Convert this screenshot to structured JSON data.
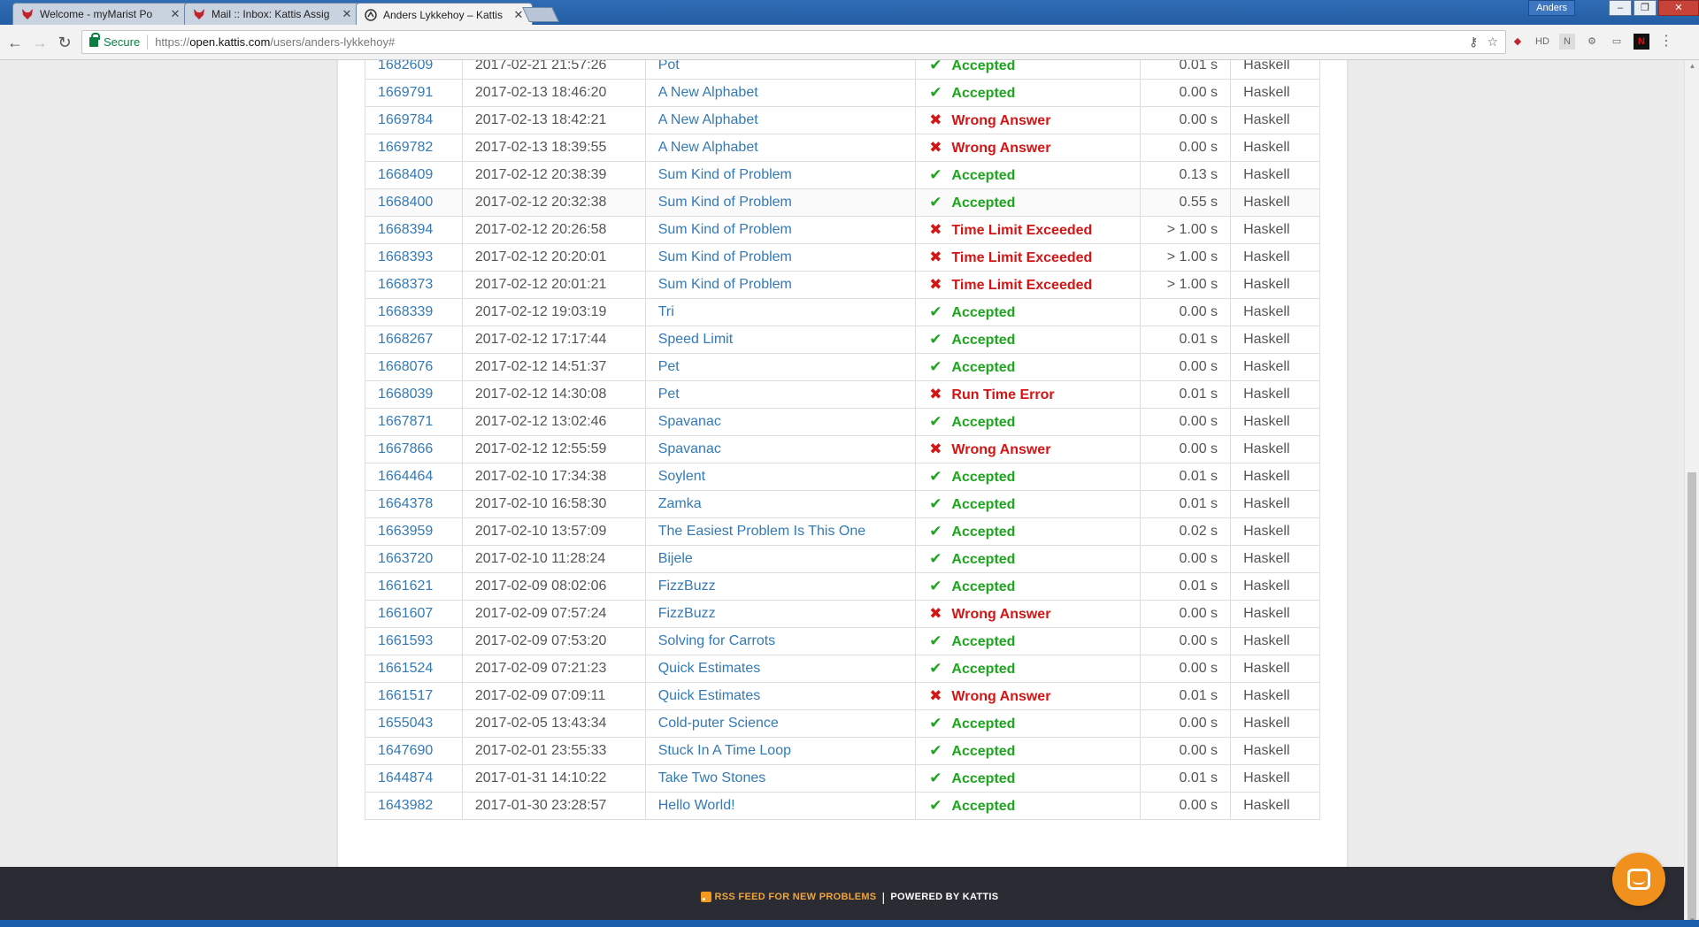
{
  "browser": {
    "tabs": [
      {
        "title": "Welcome - myMarist Po",
        "icon": "marist-fox-icon",
        "active": false
      },
      {
        "title": "Mail :: Inbox: Kattis Assig",
        "icon": "marist-fox-icon",
        "active": false
      },
      {
        "title": "Anders Lykkehoy – Kattis",
        "icon": "kattis-icon",
        "active": true
      }
    ],
    "user_chip": "Anders",
    "secure_label": "Secure",
    "url_scheme": "https://",
    "url_domain": "open.kattis.com",
    "url_path": "/users/anders-lykkehoy#",
    "ext_labels": [
      "HD",
      "N"
    ]
  },
  "submissions": {
    "rows": [
      {
        "id": "1682609",
        "time": "2017-02-21 21:57:26",
        "problem": "Pot",
        "status": "Accepted",
        "ok": true,
        "cpu": "0.01 s",
        "lang": "Haskell"
      },
      {
        "id": "1669791",
        "time": "2017-02-13 18:46:20",
        "problem": "A New Alphabet",
        "status": "Accepted",
        "ok": true,
        "cpu": "0.00 s",
        "lang": "Haskell"
      },
      {
        "id": "1669784",
        "time": "2017-02-13 18:42:21",
        "problem": "A New Alphabet",
        "status": "Wrong Answer",
        "ok": false,
        "cpu": "0.00 s",
        "lang": "Haskell"
      },
      {
        "id": "1669782",
        "time": "2017-02-13 18:39:55",
        "problem": "A New Alphabet",
        "status": "Wrong Answer",
        "ok": false,
        "cpu": "0.00 s",
        "lang": "Haskell"
      },
      {
        "id": "1668409",
        "time": "2017-02-12 20:38:39",
        "problem": "Sum Kind of Problem",
        "status": "Accepted",
        "ok": true,
        "cpu": "0.13 s",
        "lang": "Haskell"
      },
      {
        "id": "1668400",
        "time": "2017-02-12 20:32:38",
        "problem": "Sum Kind of Problem",
        "status": "Accepted",
        "ok": true,
        "cpu": "0.55 s",
        "lang": "Haskell"
      },
      {
        "id": "1668394",
        "time": "2017-02-12 20:26:58",
        "problem": "Sum Kind of Problem",
        "status": "Time Limit Exceeded",
        "ok": false,
        "cpu": "> 1.00 s",
        "lang": "Haskell"
      },
      {
        "id": "1668393",
        "time": "2017-02-12 20:20:01",
        "problem": "Sum Kind of Problem",
        "status": "Time Limit Exceeded",
        "ok": false,
        "cpu": "> 1.00 s",
        "lang": "Haskell"
      },
      {
        "id": "1668373",
        "time": "2017-02-12 20:01:21",
        "problem": "Sum Kind of Problem",
        "status": "Time Limit Exceeded",
        "ok": false,
        "cpu": "> 1.00 s",
        "lang": "Haskell"
      },
      {
        "id": "1668339",
        "time": "2017-02-12 19:03:19",
        "problem": "Tri",
        "status": "Accepted",
        "ok": true,
        "cpu": "0.00 s",
        "lang": "Haskell"
      },
      {
        "id": "1668267",
        "time": "2017-02-12 17:17:44",
        "problem": "Speed Limit",
        "status": "Accepted",
        "ok": true,
        "cpu": "0.01 s",
        "lang": "Haskell"
      },
      {
        "id": "1668076",
        "time": "2017-02-12 14:51:37",
        "problem": "Pet",
        "status": "Accepted",
        "ok": true,
        "cpu": "0.00 s",
        "lang": "Haskell"
      },
      {
        "id": "1668039",
        "time": "2017-02-12 14:30:08",
        "problem": "Pet",
        "status": "Run Time Error",
        "ok": false,
        "cpu": "0.01 s",
        "lang": "Haskell"
      },
      {
        "id": "1667871",
        "time": "2017-02-12 13:02:46",
        "problem": "Spavanac",
        "status": "Accepted",
        "ok": true,
        "cpu": "0.00 s",
        "lang": "Haskell"
      },
      {
        "id": "1667866",
        "time": "2017-02-12 12:55:59",
        "problem": "Spavanac",
        "status": "Wrong Answer",
        "ok": false,
        "cpu": "0.00 s",
        "lang": "Haskell"
      },
      {
        "id": "1664464",
        "time": "2017-02-10 17:34:38",
        "problem": "Soylent",
        "status": "Accepted",
        "ok": true,
        "cpu": "0.01 s",
        "lang": "Haskell"
      },
      {
        "id": "1664378",
        "time": "2017-02-10 16:58:30",
        "problem": "Zamka",
        "status": "Accepted",
        "ok": true,
        "cpu": "0.01 s",
        "lang": "Haskell"
      },
      {
        "id": "1663959",
        "time": "2017-02-10 13:57:09",
        "problem": "The Easiest Problem Is This One",
        "status": "Accepted",
        "ok": true,
        "cpu": "0.02 s",
        "lang": "Haskell"
      },
      {
        "id": "1663720",
        "time": "2017-02-10 11:28:24",
        "problem": "Bijele",
        "status": "Accepted",
        "ok": true,
        "cpu": "0.00 s",
        "lang": "Haskell"
      },
      {
        "id": "1661621",
        "time": "2017-02-09 08:02:06",
        "problem": "FizzBuzz",
        "status": "Accepted",
        "ok": true,
        "cpu": "0.01 s",
        "lang": "Haskell"
      },
      {
        "id": "1661607",
        "time": "2017-02-09 07:57:24",
        "problem": "FizzBuzz",
        "status": "Wrong Answer",
        "ok": false,
        "cpu": "0.00 s",
        "lang": "Haskell"
      },
      {
        "id": "1661593",
        "time": "2017-02-09 07:53:20",
        "problem": "Solving for Carrots",
        "status": "Accepted",
        "ok": true,
        "cpu": "0.00 s",
        "lang": "Haskell"
      },
      {
        "id": "1661524",
        "time": "2017-02-09 07:21:23",
        "problem": "Quick Estimates",
        "status": "Accepted",
        "ok": true,
        "cpu": "0.00 s",
        "lang": "Haskell"
      },
      {
        "id": "1661517",
        "time": "2017-02-09 07:09:11",
        "problem": "Quick Estimates",
        "status": "Wrong Answer",
        "ok": false,
        "cpu": "0.01 s",
        "lang": "Haskell"
      },
      {
        "id": "1655043",
        "time": "2017-02-05 13:43:34",
        "problem": "Cold-puter Science",
        "status": "Accepted",
        "ok": true,
        "cpu": "0.00 s",
        "lang": "Haskell"
      },
      {
        "id": "1647690",
        "time": "2017-02-01 23:55:33",
        "problem": "Stuck In A Time Loop",
        "status": "Accepted",
        "ok": true,
        "cpu": "0.00 s",
        "lang": "Haskell"
      },
      {
        "id": "1644874",
        "time": "2017-01-31 14:10:22",
        "problem": "Take Two Stones",
        "status": "Accepted",
        "ok": true,
        "cpu": "0.01 s",
        "lang": "Haskell"
      },
      {
        "id": "1643982",
        "time": "2017-01-30 23:28:57",
        "problem": "Hello World!",
        "status": "Accepted",
        "ok": true,
        "cpu": "0.00 s",
        "lang": "Haskell"
      }
    ]
  },
  "footer": {
    "rss_label": "RSS FEED FOR NEW PROBLEMS",
    "separator": "|",
    "powered_label": "POWERED BY KATTIS"
  },
  "colors": {
    "accepted": "#1ea51e",
    "rejected": "#d41515",
    "link": "#337ab7",
    "footer_bg": "#2b2b34",
    "chat_button": "#f0911e"
  }
}
